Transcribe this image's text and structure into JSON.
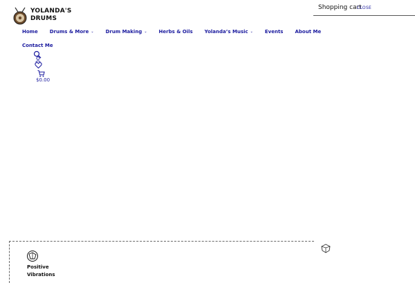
{
  "logo": {
    "line1": "YOLANDA'S",
    "line2": "DRUMS"
  },
  "nav": {
    "items": [
      {
        "label": "Home",
        "has_dropdown": false
      },
      {
        "label": "Drums & More",
        "has_dropdown": true
      },
      {
        "label": "Drum Making",
        "has_dropdown": true
      },
      {
        "label": "Herbs & Oils",
        "has_dropdown": false
      },
      {
        "label": "Yolanda’s Music",
        "has_dropdown": true
      },
      {
        "label": "Events",
        "has_dropdown": false
      },
      {
        "label": "About Me",
        "has_dropdown": false
      }
    ],
    "second_row": {
      "label": "Contact Me"
    }
  },
  "header_icons": {
    "search_icon": "search-icon",
    "account_icon": "user-icon",
    "wishlist_icon": "heart-icon",
    "cart_icon": "cart-icon",
    "cart_total": "$0.00"
  },
  "cart_panel": {
    "title": "Shopping cart",
    "close_label": "CLOSE"
  },
  "feature": {
    "icon": "positive-vibrations-icon",
    "label": "Positive Vibrations"
  },
  "colors": {
    "link": "#1a1a9e",
    "text": "#111111",
    "background": "#ffffff"
  }
}
